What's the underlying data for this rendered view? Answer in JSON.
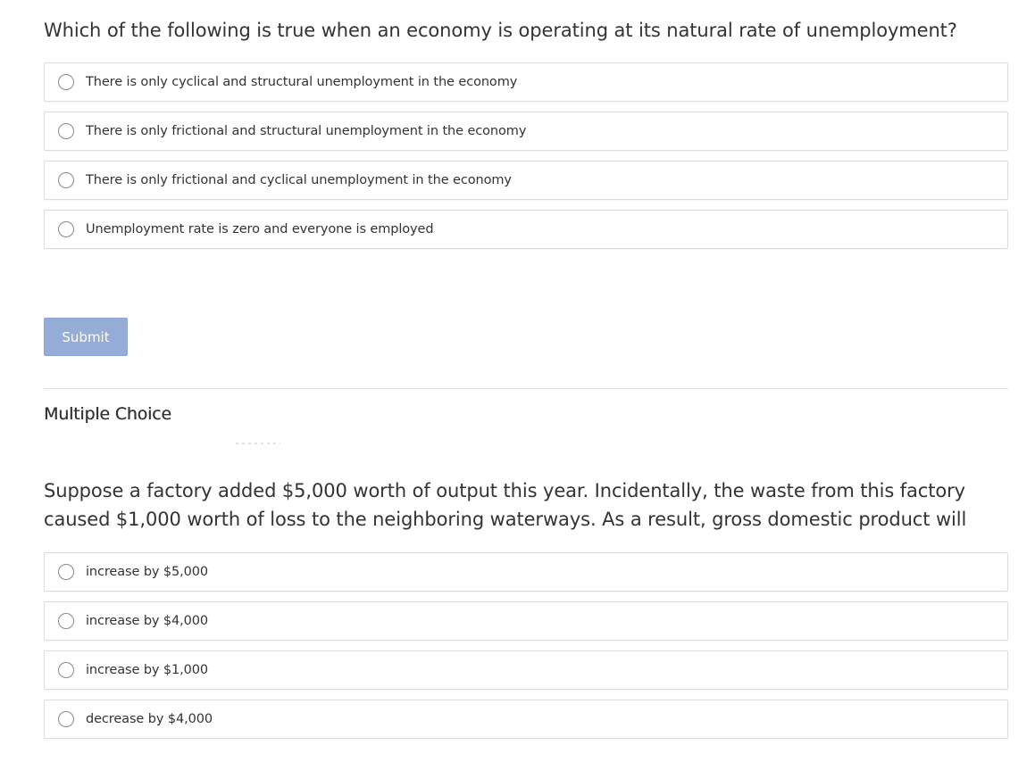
{
  "question1": {
    "text": "Which of the following is true when an economy is operating at its natural rate of unemployment?",
    "options": [
      {
        "label": "There is only cyclical and structural unemployment in the economy",
        "selected": false
      },
      {
        "label": "There is only frictional and structural unemployment in the economy",
        "selected": false
      },
      {
        "label": "There is only frictional and cyclical unemployment in the economy",
        "selected": false
      },
      {
        "label": "Unemployment rate is zero and everyone is employed",
        "selected": false
      }
    ],
    "submit_label": "Submit"
  },
  "section2": {
    "heading": "Multiple Choice"
  },
  "question2": {
    "text": "Suppose a factory added $5,000 worth of output this year. Incidentally, the waste from this factory caused $1,000 worth of loss to the neighboring waterways. As a result, gross domestic product will",
    "options": [
      {
        "label": "increase by $5,000",
        "selected": false
      },
      {
        "label": "increase by $4,000",
        "selected": false
      },
      {
        "label": "increase by $1,000",
        "selected": false
      },
      {
        "label": "decrease by $4,000",
        "selected": false
      }
    ]
  },
  "colors": {
    "text": "#333333",
    "submit_bg": "#95acd6",
    "border": "#dddddd"
  }
}
